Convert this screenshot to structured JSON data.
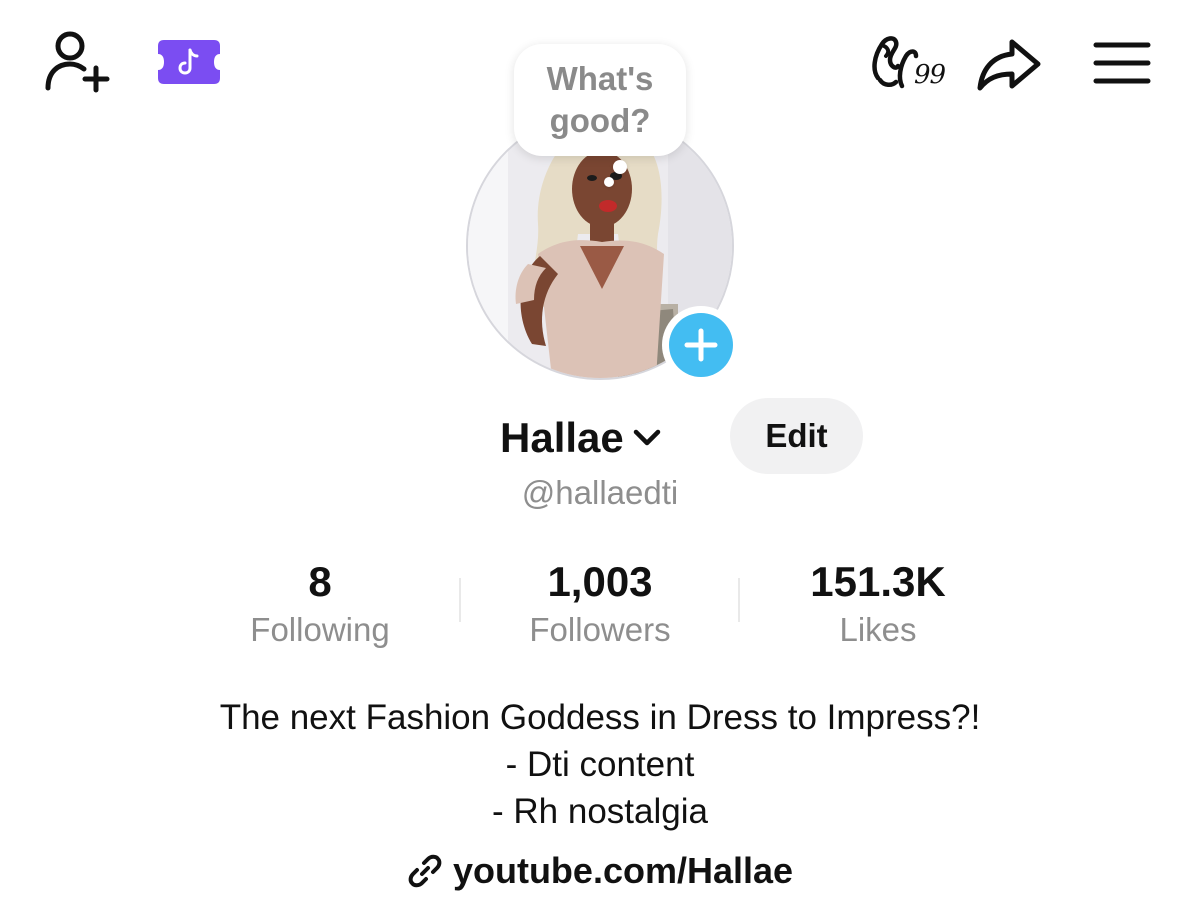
{
  "header": {
    "add_friend_icon": "person-plus-icon",
    "promo_icon": "tiktok-ticket-icon",
    "streak_icon": "streak-fire-icon",
    "streak_count": "99",
    "share_icon": "share-arrow-icon",
    "menu_icon": "hamburger-menu-icon",
    "promo_color": "#7b4df2"
  },
  "profile": {
    "note": "What's good?",
    "display_name": "Hallae",
    "username": "@hallaedti",
    "edit_label": "Edit",
    "avatar_add_color": "#43bdf2"
  },
  "stats": [
    {
      "value": "8",
      "label": "Following"
    },
    {
      "value": "1,003",
      "label": "Followers"
    },
    {
      "value": "151.3K",
      "label": "Likes"
    }
  ],
  "bio": {
    "lines": [
      "The next Fashion Goddess in Dress to Impress?!",
      "- Dti content",
      "- Rh nostalgia"
    ],
    "link": "youtube.com/Hallae"
  }
}
